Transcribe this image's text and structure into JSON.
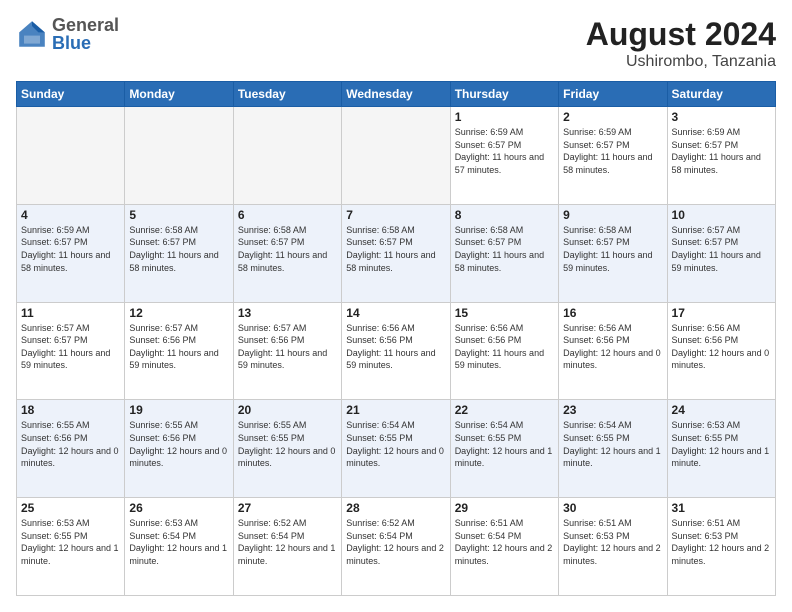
{
  "header": {
    "logo_general": "General",
    "logo_blue": "Blue",
    "month_title": "August 2024",
    "location": "Ushirombo, Tanzania"
  },
  "days_of_week": [
    "Sunday",
    "Monday",
    "Tuesday",
    "Wednesday",
    "Thursday",
    "Friday",
    "Saturday"
  ],
  "weeks": [
    [
      {
        "day": "",
        "sunrise": "",
        "sunset": "",
        "daylight": "",
        "empty": true
      },
      {
        "day": "",
        "sunrise": "",
        "sunset": "",
        "daylight": "",
        "empty": true
      },
      {
        "day": "",
        "sunrise": "",
        "sunset": "",
        "daylight": "",
        "empty": true
      },
      {
        "day": "",
        "sunrise": "",
        "sunset": "",
        "daylight": "",
        "empty": true
      },
      {
        "day": "1",
        "sunrise": "Sunrise: 6:59 AM",
        "sunset": "Sunset: 6:57 PM",
        "daylight": "Daylight: 11 hours and 57 minutes.",
        "empty": false
      },
      {
        "day": "2",
        "sunrise": "Sunrise: 6:59 AM",
        "sunset": "Sunset: 6:57 PM",
        "daylight": "Daylight: 11 hours and 58 minutes.",
        "empty": false
      },
      {
        "day": "3",
        "sunrise": "Sunrise: 6:59 AM",
        "sunset": "Sunset: 6:57 PM",
        "daylight": "Daylight: 11 hours and 58 minutes.",
        "empty": false
      }
    ],
    [
      {
        "day": "4",
        "sunrise": "Sunrise: 6:59 AM",
        "sunset": "Sunset: 6:57 PM",
        "daylight": "Daylight: 11 hours and 58 minutes.",
        "empty": false
      },
      {
        "day": "5",
        "sunrise": "Sunrise: 6:58 AM",
        "sunset": "Sunset: 6:57 PM",
        "daylight": "Daylight: 11 hours and 58 minutes.",
        "empty": false
      },
      {
        "day": "6",
        "sunrise": "Sunrise: 6:58 AM",
        "sunset": "Sunset: 6:57 PM",
        "daylight": "Daylight: 11 hours and 58 minutes.",
        "empty": false
      },
      {
        "day": "7",
        "sunrise": "Sunrise: 6:58 AM",
        "sunset": "Sunset: 6:57 PM",
        "daylight": "Daylight: 11 hours and 58 minutes.",
        "empty": false
      },
      {
        "day": "8",
        "sunrise": "Sunrise: 6:58 AM",
        "sunset": "Sunset: 6:57 PM",
        "daylight": "Daylight: 11 hours and 58 minutes.",
        "empty": false
      },
      {
        "day": "9",
        "sunrise": "Sunrise: 6:58 AM",
        "sunset": "Sunset: 6:57 PM",
        "daylight": "Daylight: 11 hours and 59 minutes.",
        "empty": false
      },
      {
        "day": "10",
        "sunrise": "Sunrise: 6:57 AM",
        "sunset": "Sunset: 6:57 PM",
        "daylight": "Daylight: 11 hours and 59 minutes.",
        "empty": false
      }
    ],
    [
      {
        "day": "11",
        "sunrise": "Sunrise: 6:57 AM",
        "sunset": "Sunset: 6:57 PM",
        "daylight": "Daylight: 11 hours and 59 minutes.",
        "empty": false
      },
      {
        "day": "12",
        "sunrise": "Sunrise: 6:57 AM",
        "sunset": "Sunset: 6:56 PM",
        "daylight": "Daylight: 11 hours and 59 minutes.",
        "empty": false
      },
      {
        "day": "13",
        "sunrise": "Sunrise: 6:57 AM",
        "sunset": "Sunset: 6:56 PM",
        "daylight": "Daylight: 11 hours and 59 minutes.",
        "empty": false
      },
      {
        "day": "14",
        "sunrise": "Sunrise: 6:56 AM",
        "sunset": "Sunset: 6:56 PM",
        "daylight": "Daylight: 11 hours and 59 minutes.",
        "empty": false
      },
      {
        "day": "15",
        "sunrise": "Sunrise: 6:56 AM",
        "sunset": "Sunset: 6:56 PM",
        "daylight": "Daylight: 11 hours and 59 minutes.",
        "empty": false
      },
      {
        "day": "16",
        "sunrise": "Sunrise: 6:56 AM",
        "sunset": "Sunset: 6:56 PM",
        "daylight": "Daylight: 12 hours and 0 minutes.",
        "empty": false
      },
      {
        "day": "17",
        "sunrise": "Sunrise: 6:56 AM",
        "sunset": "Sunset: 6:56 PM",
        "daylight": "Daylight: 12 hours and 0 minutes.",
        "empty": false
      }
    ],
    [
      {
        "day": "18",
        "sunrise": "Sunrise: 6:55 AM",
        "sunset": "Sunset: 6:56 PM",
        "daylight": "Daylight: 12 hours and 0 minutes.",
        "empty": false
      },
      {
        "day": "19",
        "sunrise": "Sunrise: 6:55 AM",
        "sunset": "Sunset: 6:56 PM",
        "daylight": "Daylight: 12 hours and 0 minutes.",
        "empty": false
      },
      {
        "day": "20",
        "sunrise": "Sunrise: 6:55 AM",
        "sunset": "Sunset: 6:55 PM",
        "daylight": "Daylight: 12 hours and 0 minutes.",
        "empty": false
      },
      {
        "day": "21",
        "sunrise": "Sunrise: 6:54 AM",
        "sunset": "Sunset: 6:55 PM",
        "daylight": "Daylight: 12 hours and 0 minutes.",
        "empty": false
      },
      {
        "day": "22",
        "sunrise": "Sunrise: 6:54 AM",
        "sunset": "Sunset: 6:55 PM",
        "daylight": "Daylight: 12 hours and 1 minute.",
        "empty": false
      },
      {
        "day": "23",
        "sunrise": "Sunrise: 6:54 AM",
        "sunset": "Sunset: 6:55 PM",
        "daylight": "Daylight: 12 hours and 1 minute.",
        "empty": false
      },
      {
        "day": "24",
        "sunrise": "Sunrise: 6:53 AM",
        "sunset": "Sunset: 6:55 PM",
        "daylight": "Daylight: 12 hours and 1 minute.",
        "empty": false
      }
    ],
    [
      {
        "day": "25",
        "sunrise": "Sunrise: 6:53 AM",
        "sunset": "Sunset: 6:55 PM",
        "daylight": "Daylight: 12 hours and 1 minute.",
        "empty": false
      },
      {
        "day": "26",
        "sunrise": "Sunrise: 6:53 AM",
        "sunset": "Sunset: 6:54 PM",
        "daylight": "Daylight: 12 hours and 1 minute.",
        "empty": false
      },
      {
        "day": "27",
        "sunrise": "Sunrise: 6:52 AM",
        "sunset": "Sunset: 6:54 PM",
        "daylight": "Daylight: 12 hours and 1 minute.",
        "empty": false
      },
      {
        "day": "28",
        "sunrise": "Sunrise: 6:52 AM",
        "sunset": "Sunset: 6:54 PM",
        "daylight": "Daylight: 12 hours and 2 minutes.",
        "empty": false
      },
      {
        "day": "29",
        "sunrise": "Sunrise: 6:51 AM",
        "sunset": "Sunset: 6:54 PM",
        "daylight": "Daylight: 12 hours and 2 minutes.",
        "empty": false
      },
      {
        "day": "30",
        "sunrise": "Sunrise: 6:51 AM",
        "sunset": "Sunset: 6:53 PM",
        "daylight": "Daylight: 12 hours and 2 minutes.",
        "empty": false
      },
      {
        "day": "31",
        "sunrise": "Sunrise: 6:51 AM",
        "sunset": "Sunset: 6:53 PM",
        "daylight": "Daylight: 12 hours and 2 minutes.",
        "empty": false
      }
    ]
  ]
}
